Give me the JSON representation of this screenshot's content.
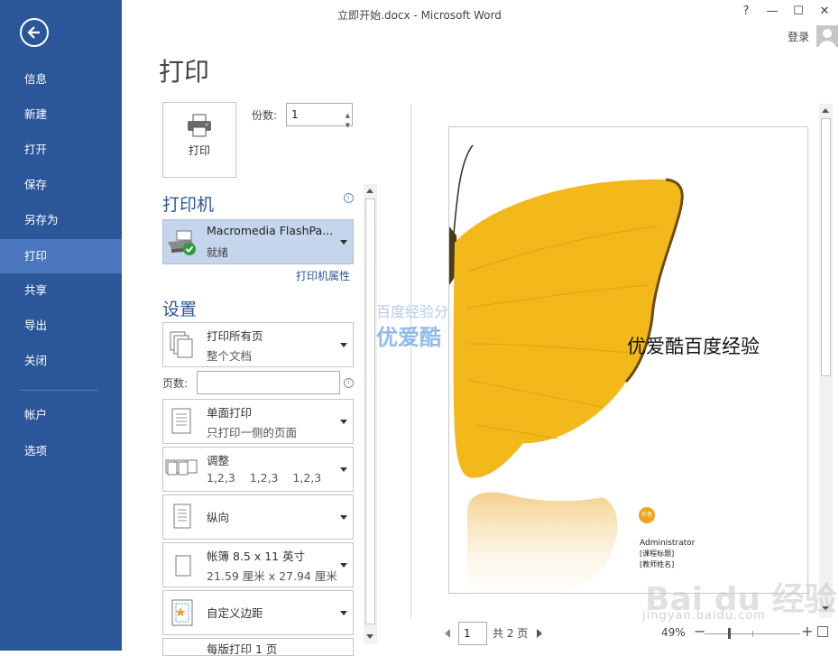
{
  "window": {
    "title": "立即开始.docx - Microsoft Word",
    "controls": {
      "help": "?",
      "minimize": "—",
      "maximize": "☐",
      "close": "✕"
    },
    "login": "登录"
  },
  "sidebar": {
    "back_icon": "back-arrow-icon",
    "items": [
      {
        "label": "信息",
        "active": false
      },
      {
        "label": "新建",
        "active": false
      },
      {
        "label": "打开",
        "active": false
      },
      {
        "label": "保存",
        "active": false
      },
      {
        "label": "另存为",
        "active": false
      },
      {
        "label": "打印",
        "active": true
      },
      {
        "label": "共享",
        "active": false
      },
      {
        "label": "导出",
        "active": false
      },
      {
        "label": "关闭",
        "active": false
      },
      {
        "label": "帐户",
        "active": false
      },
      {
        "label": "选项",
        "active": false
      }
    ]
  },
  "print": {
    "title": "打印",
    "button_label": "打印",
    "copies_label": "份数:",
    "copies_value": "1"
  },
  "printer": {
    "section_title": "打印机",
    "name": "Macromedia FlashPa...",
    "status": "就绪",
    "properties_link": "打印机属性"
  },
  "settings": {
    "section_title": "设置",
    "pages_label": "页数:",
    "pages_value": "",
    "items": [
      {
        "main": "打印所有页",
        "sub": "整个文档",
        "icon": "print-all-pages-icon"
      },
      {
        "main": "单面打印",
        "sub": "只打印一侧的页面",
        "icon": "one-sided-icon"
      },
      {
        "main": "调整",
        "sub": "1,2,3    1,2,3    1,2,3",
        "icon": "collated-icon"
      },
      {
        "main": "纵向",
        "sub": "",
        "icon": "portrait-icon"
      },
      {
        "main": "帐簿 8.5 x 11 英寸",
        "sub": "21.59 厘米 x 27.94 厘米",
        "icon": "paper-size-icon"
      },
      {
        "main": "自定义边距",
        "sub": "",
        "icon": "margins-icon"
      },
      {
        "main": "每版打印 1 页",
        "sub": "",
        "icon": "pages-per-sheet-icon"
      }
    ]
  },
  "preview": {
    "doc_title": "优爱酷百度经验",
    "author_badge": "作者",
    "author": "Administrator",
    "course_title": "[课程标题]",
    "teacher_name": "[教师姓名]",
    "current_page": "1",
    "total_pages": "共 2 页",
    "zoom": "49%"
  },
  "watermarks": {
    "top": "百度经验分",
    "mid": "优爱酷",
    "baidu": "Bai du 经验",
    "url": "jingyan.baidu.com"
  },
  "colors": {
    "sidebar": "#2b579a",
    "sidebar_active": "#4a76bd",
    "accent": "#2b579a",
    "printer_selected": "#c5d5ec",
    "butterfly": "#f3b81a"
  }
}
